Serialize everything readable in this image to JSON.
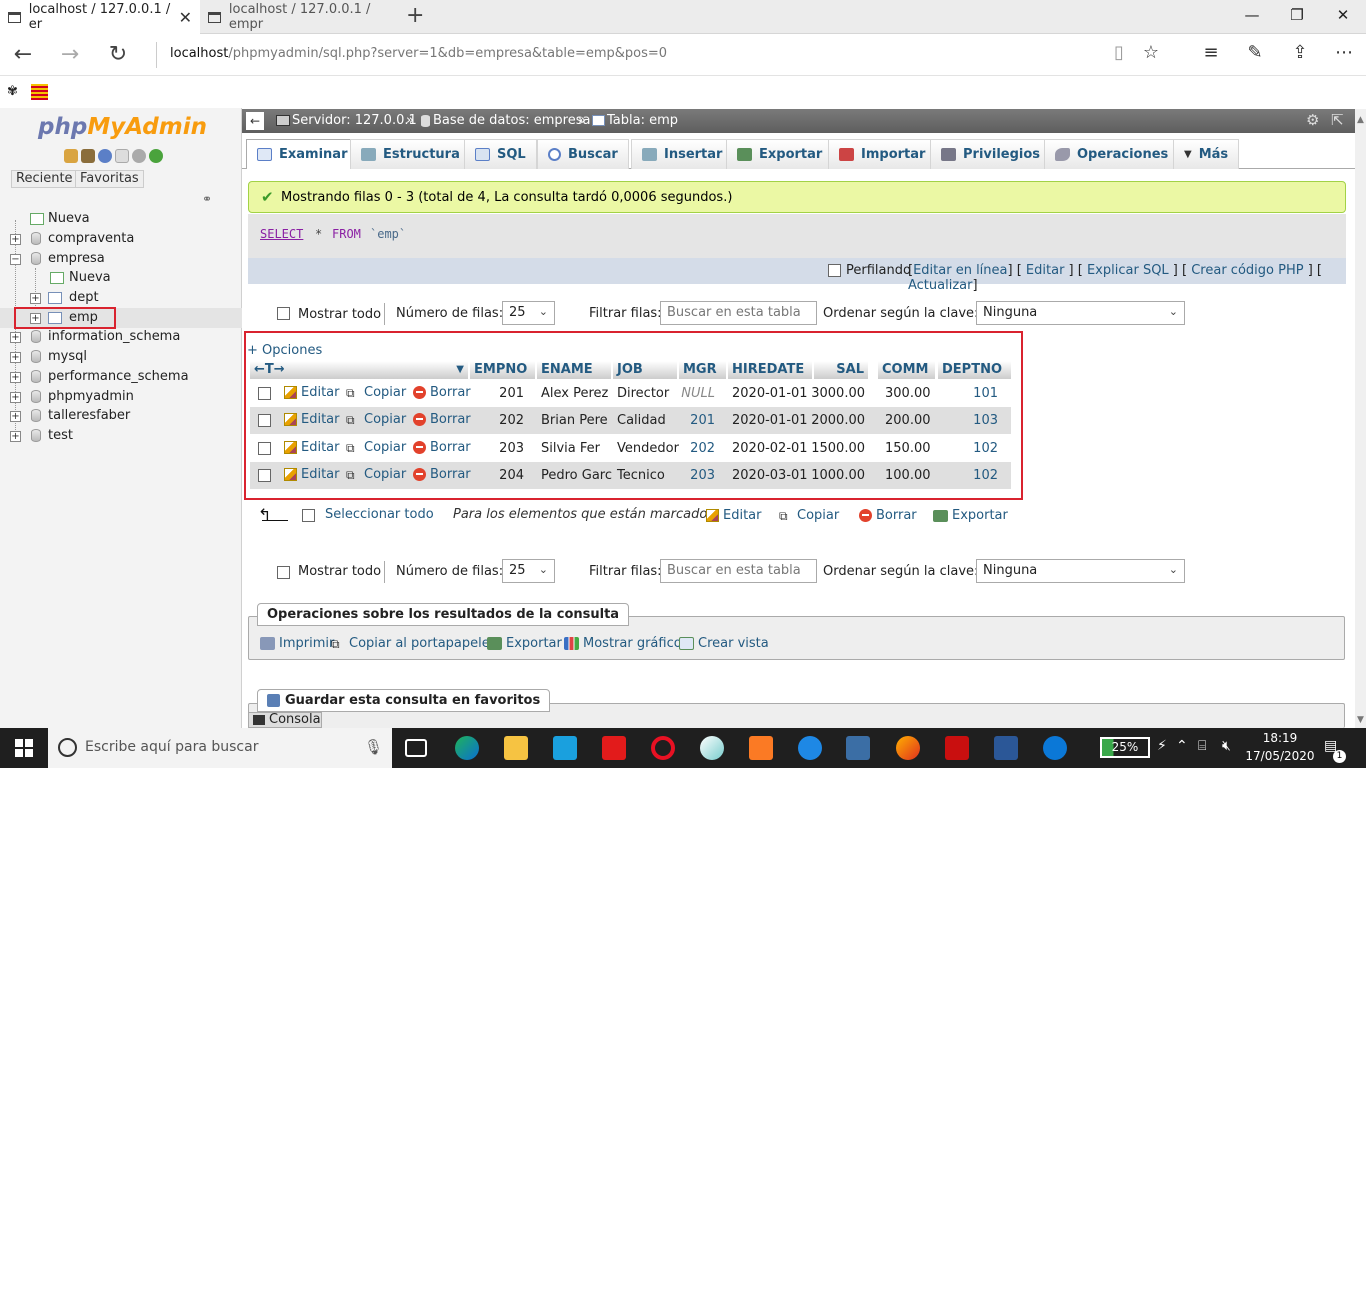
{
  "browser": {
    "tabs": [
      {
        "title": "localhost / 127.0.0.1 / er"
      },
      {
        "title": "localhost / 127.0.0.1 / empr"
      }
    ],
    "url_host": "localhost",
    "url_path": "/phpmyadmin/sql.php?server=1&db=empresa&table=emp&pos=0"
  },
  "nav": {
    "logo_php": "php",
    "logo_myadmin": "MyAdmin",
    "tab_recent": "Reciente",
    "tab_favorites": "Favoritas",
    "tree": [
      {
        "label": "Nueva",
        "level": 1
      },
      {
        "label": "compraventa",
        "level": 0
      },
      {
        "label": "empresa",
        "level": 0
      },
      {
        "label": "Nueva",
        "level": 2
      },
      {
        "label": "dept",
        "level": 2
      },
      {
        "label": "emp",
        "level": 2
      },
      {
        "label": "information_schema",
        "level": 0
      },
      {
        "label": "mysql",
        "level": 0
      },
      {
        "label": "performance_schema",
        "level": 0
      },
      {
        "label": "phpmyadmin",
        "level": 0
      },
      {
        "label": "talleresfaber",
        "level": 0
      },
      {
        "label": "test",
        "level": 0
      }
    ]
  },
  "breadcrumb": {
    "server": "Servidor: 127.0.0.1",
    "sep": "»",
    "database": "Base de datos: empresa",
    "table": "Tabla: emp"
  },
  "menu": [
    "Examinar",
    "Estructura",
    "SQL",
    "Buscar",
    "Insertar",
    "Exportar",
    "Importar",
    "Privilegios",
    "Operaciones",
    "Más"
  ],
  "success_message": "Mostrando filas 0 - 3 (total de 4, La consulta tardó 0,0006 segundos.)",
  "sql": {
    "kw_select": "SELECT",
    "star": "*",
    "kw_from": "FROM",
    "table": "`emp`"
  },
  "sql_links": {
    "profiling": "Perfilando",
    "items": [
      "Editar en línea",
      "Editar",
      "Explicar SQL",
      "Crear código PHP",
      "Actualizar"
    ]
  },
  "controls": {
    "show_all": "Mostrar todo",
    "rows_label": "Número de filas:",
    "rows_value": "25",
    "filter_label": "Filtrar filas:",
    "filter_placeholder": "Buscar en esta tabla",
    "sort_label": "Ordenar según la clave:",
    "sort_value": "Ninguna"
  },
  "options_link": "+ Opciones",
  "table": {
    "columns": [
      "EMPNO",
      "ENAME",
      "JOB",
      "MGR",
      "HIREDATE",
      "SAL",
      "COMM",
      "DEPTNO"
    ],
    "actions": {
      "edit": "Editar",
      "copy": "Copiar",
      "delete": "Borrar"
    },
    "rows": [
      [
        "201",
        "Alex Perez",
        "Director",
        "NULL",
        "2020-01-01",
        "3000.00",
        "300.00",
        "101"
      ],
      [
        "202",
        "Brian Pere",
        "Calidad",
        "201",
        "2020-01-01",
        "2000.00",
        "200.00",
        "103"
      ],
      [
        "203",
        "Silvia Fer",
        "Vendedor",
        "202",
        "2020-02-01",
        "1500.00",
        "150.00",
        "102"
      ],
      [
        "204",
        "Pedro Garc",
        "Tecnico",
        "203",
        "2020-03-01",
        "1000.00",
        "100.00",
        "102"
      ]
    ]
  },
  "bulk": {
    "select_all": "Seleccionar todo",
    "for_marked": "Para los elementos que están marcados:",
    "edit": "Editar",
    "copy": "Copiar",
    "delete": "Borrar",
    "export": "Exportar"
  },
  "query_ops": {
    "legend": "Operaciones sobre los resultados de la consulta",
    "items": [
      "Imprimir",
      "Copiar al portapapeles",
      "Exportar",
      "Mostrar gráfico",
      "Crear vista"
    ]
  },
  "bookmark_legend": "Guardar esta consulta en favoritos",
  "console": "Consola",
  "taskbar": {
    "search_placeholder": "Escribe aquí para buscar",
    "battery": "25%",
    "time": "18:19",
    "date": "17/05/2020",
    "notifications": "1"
  }
}
